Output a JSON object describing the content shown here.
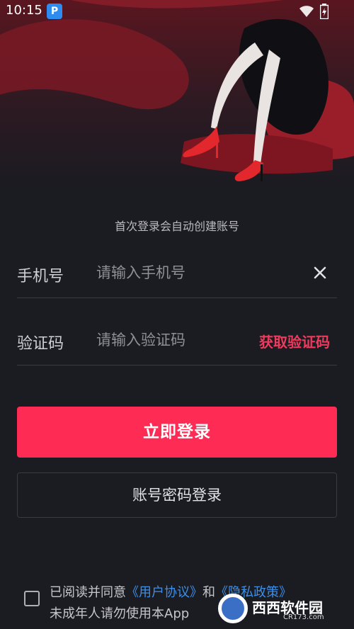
{
  "status_bar": {
    "time": "10:15",
    "app_icon_letter": "P"
  },
  "notice": "首次登录会自动创建账号",
  "phone": {
    "label": "手机号",
    "placeholder": "请输入手机号"
  },
  "code": {
    "label": "验证码",
    "placeholder": "请输入验证码",
    "get_code_label": "获取验证码"
  },
  "login_button": "立即登录",
  "password_login_button": "账号密码登录",
  "agreement": {
    "prefix": "已阅读并同意",
    "user_agreement": "《用户协议》",
    "and": "和",
    "privacy_policy": "《隐私政策》",
    "minor_notice": "未成年人请勿使用本App"
  },
  "watermark": {
    "brand": "西西软件园",
    "domain": "CR173.com"
  },
  "colors": {
    "accent": "#fe2c55",
    "background": "#1b1b22",
    "link": "#3d8fe8"
  }
}
